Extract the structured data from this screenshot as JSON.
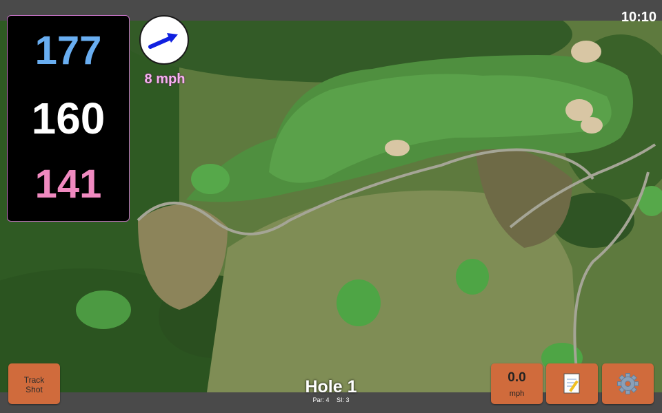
{
  "status_bar": {
    "time": "10:10"
  },
  "distances": {
    "back": "177",
    "middle": "160",
    "front": "141"
  },
  "wind": {
    "speed": "8 mph",
    "icon": "wind-direction-arrow-icon"
  },
  "track_button": {
    "label_line1": "Track",
    "label_line2": "Shot"
  },
  "hole": {
    "title": "Hole 1",
    "par": "Par: 4",
    "stroke_index": "SI: 3"
  },
  "speed_button": {
    "value": "0.0",
    "unit": "mph"
  },
  "notes_button": {
    "icon": "notepad-icon"
  },
  "settings_button": {
    "icon": "gear-icon"
  },
  "colors": {
    "back": "#69aef1",
    "middle": "#ffffff",
    "front": "#f08ac0",
    "wind_text": "#f7b0f0",
    "button": "#d06b3c"
  }
}
